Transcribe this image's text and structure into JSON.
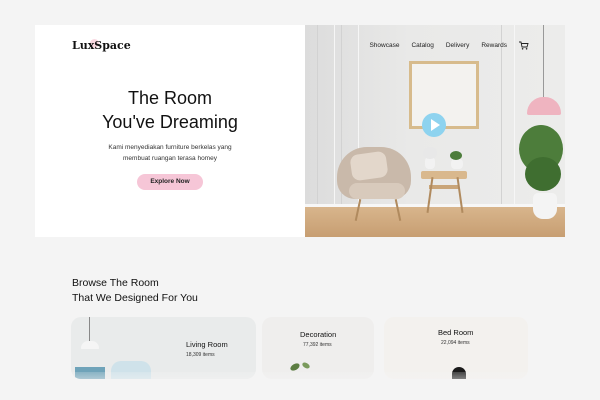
{
  "brand": {
    "logo": "LuxSpace"
  },
  "nav": {
    "items": [
      "Showcase",
      "Catalog",
      "Delivery",
      "Rewards"
    ],
    "cart_icon": "cart-icon"
  },
  "hero": {
    "title_line1": "The Room",
    "title_line2": "You've Dreaming",
    "subtitle_line1": "Kami menyediakan furniture berkelas yang",
    "subtitle_line2": "membuat ruangan terasa homey",
    "cta_label": "Explore Now",
    "play_icon": "play-icon"
  },
  "browse": {
    "heading_line1": "Browse The Room",
    "heading_line2": "That We Designed For You",
    "categories": [
      {
        "name": "Living Room",
        "count": "18,309 items"
      },
      {
        "name": "Decoration",
        "count": "77,392 items"
      },
      {
        "name": "Bed Room",
        "count": "22,094 items"
      }
    ]
  },
  "colors": {
    "accent_pink": "#f6c6d7",
    "play_blue": "#8ed3ef",
    "page_bg": "#f4f4f4"
  }
}
